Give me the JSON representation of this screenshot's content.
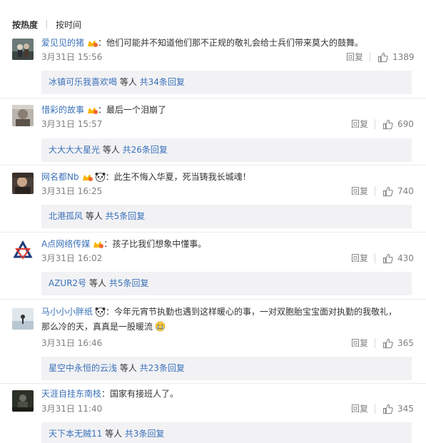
{
  "tabs": [
    {
      "label": "按热度",
      "active": true
    },
    {
      "label": "按时间",
      "active": false
    }
  ],
  "reply_label": "回复",
  "comments": [
    {
      "username": "爱见见的猪",
      "text": "：他们可能并不知道他们那不正规的敬礼会给士兵们带来莫大的鼓舞。",
      "time": "3月31日 15:56",
      "likes": "1389",
      "reply_name": "冰镇可乐我喜欢喝",
      "reply_etc": " 等人 ",
      "reply_count": "共34条回复",
      "badges": [
        "vip-badge-icon"
      ]
    },
    {
      "username": "惜彩的故事",
      "text": "：最后一个泪崩了",
      "time": "3月31日 15:57",
      "likes": "690",
      "reply_name": "大大大大星光",
      "reply_etc": " 等人 ",
      "reply_count": "共26条回复",
      "badges": [
        "vip-badge-icon"
      ]
    },
    {
      "username": "网名都Nb",
      "text": "：此生不悔入华夏，死当铸我长城魂！",
      "time": "3月31日 16:25",
      "likes": "740",
      "reply_name": "北港孤风",
      "reply_etc": " 等人 ",
      "reply_count": "共5条回复",
      "badges": [
        "vip-badge-icon",
        "panda-icon"
      ]
    },
    {
      "username": "A点网络传媒",
      "text": "：孩子比我们想象中懂事。",
      "time": "3月31日 16:02",
      "likes": "430",
      "reply_name": "AZUR2号",
      "reply_etc": " 等人 ",
      "reply_count": "共5条回复",
      "badges": [
        "vip-badge-icon"
      ]
    },
    {
      "username": "马小小小胖纸",
      "text": "：今年元宵节执勤也遇到这样暖心的事，一对双胞胎宝宝面对执勤的我敬礼，",
      "text2": "那么冷的天，真真是一股暖流",
      "time": "3月31日 16:46",
      "likes": "365",
      "reply_name": "星空中永恒的云浅",
      "reply_etc": " 等人 ",
      "reply_count": "共23条回复",
      "badges": [
        "panda-icon"
      ]
    },
    {
      "username": "天涯自挂东南枝",
      "text": "：国家有接班人了。",
      "time": "3月31日 11:40",
      "likes": "345",
      "reply_name": "天下本无贼11",
      "reply_etc": " 等人 ",
      "reply_count": "共3条回复",
      "badges": []
    }
  ],
  "colors": {
    "link": "#eb7350",
    "meta": "#808080",
    "reply_bg": "#f2f2f5"
  }
}
